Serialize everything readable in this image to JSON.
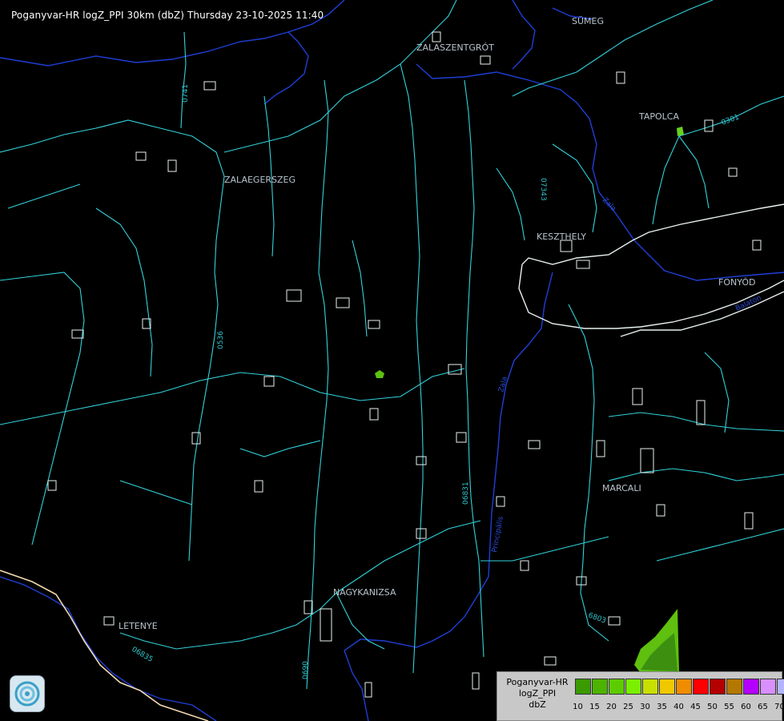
{
  "header": {
    "title": "Poganyvar-HR logZ_PPI 30km (dbZ) Thursday 23-10-2025 11:40"
  },
  "towns": [
    "SÜMEG",
    "ZALASZENTGRÓT",
    "TAPOLCA",
    "ZALAEGERSZEG",
    "KESZTHELY",
    "FONYÓD",
    "MARCALI",
    "NAGYKANIZSA",
    "LETENYE"
  ],
  "roads": [
    "0741",
    "07343",
    "0536",
    "06831",
    "06835",
    "0301",
    "6803",
    "0690"
  ],
  "rivers": [
    "Zala",
    "Balaton",
    "Zala",
    "Principális"
  ],
  "legend": {
    "name_line1": "Poganyvar-HR",
    "name_line2": "logZ_PPI",
    "name_line3": "dbZ",
    "ticks": [
      "10",
      "15",
      "20",
      "25",
      "30",
      "35",
      "40",
      "45",
      "50",
      "55",
      "60",
      "65",
      "70"
    ],
    "colors": [
      "#3a9a00",
      "#4cb400",
      "#5ccc00",
      "#7af000",
      "#c8e000",
      "#f0c800",
      "#f08c00",
      "#ff0000",
      "#b40000",
      "#b47800",
      "#b400ff",
      "#d890ff",
      "#b4b4ff"
    ]
  },
  "echo_colors": {
    "weak": "#5fc010",
    "moderate": "#3d8f10"
  },
  "logo": "radar-logo-icon"
}
